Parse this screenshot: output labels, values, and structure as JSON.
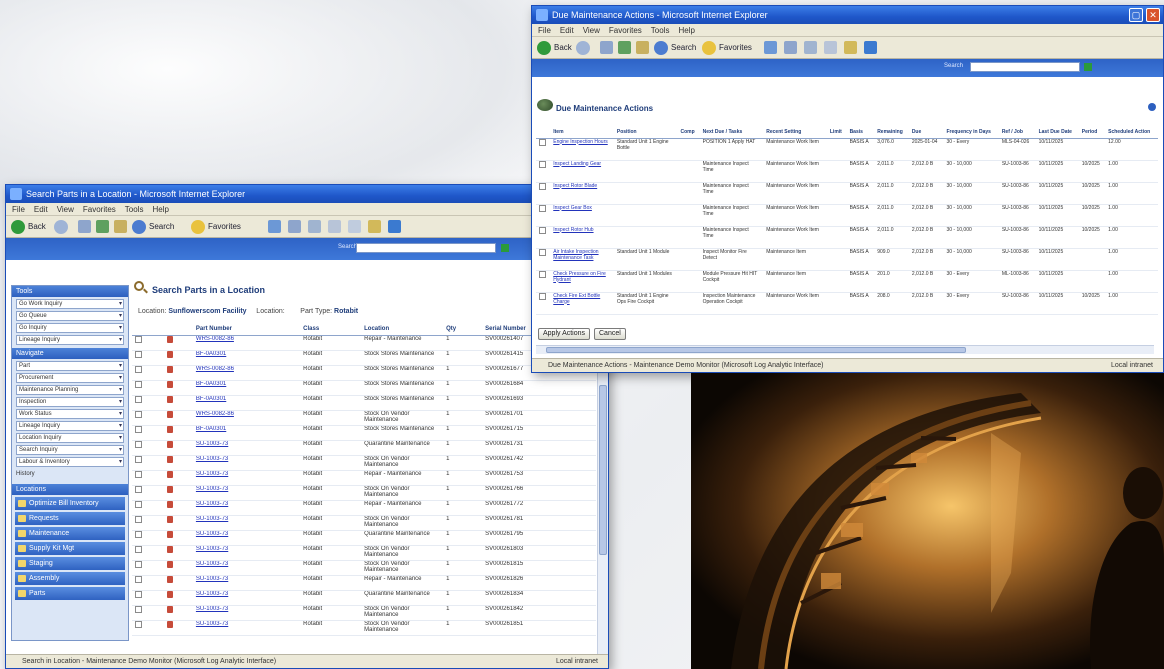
{
  "win1": {
    "title": "Search Parts in a Location - Microsoft Internet Explorer",
    "menu": [
      "File",
      "Edit",
      "View",
      "Favorites",
      "Tools",
      "Help"
    ],
    "toolbar": {
      "back": "Back",
      "search": "Search",
      "favorites": "Favorites"
    },
    "search_label": "Search",
    "page_title": "Search Parts in a Location",
    "criteria": {
      "location_label": "Location:",
      "location_value": "Sunflowerscom Facility",
      "subloc_label": "Location:",
      "parttype_label": "Part Type:",
      "parttype_value": "Rotabit"
    },
    "sidebar": {
      "header1": "Tools",
      "selects1": [
        "Go Work Inquiry",
        "Go Queue",
        "Go Inquiry",
        "Lineage Inquiry"
      ],
      "header2": "Navigate",
      "selects2": [
        "Part",
        "Procurement",
        "Maintenance Planning",
        "Inspection",
        "Work Status",
        "Lineage Inquiry",
        "Location Inquiry",
        "Search Inquiry",
        "Labour & Inventory"
      ],
      "misc": "History",
      "header3": "Locations",
      "nav": [
        "Optimize Bill Inventory",
        "Requests",
        "Maintenance",
        "Supply Kit Mgt",
        "Staging",
        "Assembly",
        "Parts"
      ]
    },
    "table": {
      "headers": [
        "Part Number",
        "Class",
        "Location",
        "Qty",
        "Serial Number"
      ],
      "rows": [
        {
          "part": "WRS-0082-86",
          "cls": "Rotabit",
          "loc": "Repair - Maintenance",
          "qty": "1",
          "serial": "SV000261407"
        },
        {
          "part": "BF-0A0301",
          "cls": "Rotabit",
          "loc": "Stock Stores Maintenance",
          "qty": "1",
          "serial": "SV000261415"
        },
        {
          "part": "WRS-0082-86",
          "cls": "Rotabit",
          "loc": "Stock Stores Maintenance",
          "qty": "1",
          "serial": "SV000261677"
        },
        {
          "part": "BF-0A0301",
          "cls": "Rotabit",
          "loc": "Stock Stores Maintenance",
          "qty": "1",
          "serial": "SV000261684"
        },
        {
          "part": "BF-0A0301",
          "cls": "Rotabit",
          "loc": "Stock Stores Maintenance",
          "qty": "1",
          "serial": "SV000261693"
        },
        {
          "part": "WRS-0082-86",
          "cls": "Rotabit",
          "loc": "Stock On Vendor Maintenance",
          "qty": "1",
          "serial": "SV000261701"
        },
        {
          "part": "BF-0A0301",
          "cls": "Rotabit",
          "loc": "Stock Stores Maintenance",
          "qty": "1",
          "serial": "SV000261715"
        },
        {
          "part": "SU-1003-73",
          "cls": "Rotabit",
          "loc": "Quarantine Maintenance",
          "qty": "1",
          "serial": "SV000261731"
        },
        {
          "part": "SU-1003-73",
          "cls": "Rotabit",
          "loc": "Stock On Vendor Maintenance",
          "qty": "1",
          "serial": "SV000261742"
        },
        {
          "part": "SU-1003-73",
          "cls": "Rotabit",
          "loc": "Repair - Maintenance",
          "qty": "1",
          "serial": "SV000261753"
        },
        {
          "part": "SU-1003-73",
          "cls": "Rotabit",
          "loc": "Stock On Vendor Maintenance",
          "qty": "1",
          "serial": "SV000261766"
        },
        {
          "part": "SU-1003-73",
          "cls": "Rotabit",
          "loc": "Repair - Maintenance",
          "qty": "1",
          "serial": "SV000261772"
        },
        {
          "part": "SU-1003-73",
          "cls": "Rotabit",
          "loc": "Stock On Vendor Maintenance",
          "qty": "1",
          "serial": "SV000261781"
        },
        {
          "part": "SU-1003-73",
          "cls": "Rotabit",
          "loc": "Quarantine Maintenance",
          "qty": "1",
          "serial": "SV000261795"
        },
        {
          "part": "SU-1003-73",
          "cls": "Rotabit",
          "loc": "Stock On Vendor Maintenance",
          "qty": "1",
          "serial": "SV000261803"
        },
        {
          "part": "SU-1003-73",
          "cls": "Rotabit",
          "loc": "Stock On Vendor Maintenance",
          "qty": "1",
          "serial": "SV000261815"
        },
        {
          "part": "SU-1003-73",
          "cls": "Rotabit",
          "loc": "Repair - Maintenance",
          "qty": "1",
          "serial": "SV000261826"
        },
        {
          "part": "SU-1003-73",
          "cls": "Rotabit",
          "loc": "Quarantine Maintenance",
          "qty": "1",
          "serial": "SV000261834"
        },
        {
          "part": "SU-1003-73",
          "cls": "Rotabit",
          "loc": "Stock On Vendor Maintenance",
          "qty": "1",
          "serial": "SV000261842"
        },
        {
          "part": "SU-1003-73",
          "cls": "Rotabit",
          "loc": "Stock On Vendor Maintenance",
          "qty": "1",
          "serial": "SV000261851"
        }
      ]
    },
    "status": "Search in Location - Maintenance Demo Monitor (Microsoft Log Analytic Interface)",
    "status_zone": "Local intranet"
  },
  "win2": {
    "title": "Due Maintenance Actions - Microsoft Internet Explorer",
    "menu": [
      "File",
      "Edit",
      "View",
      "Favorites",
      "Tools",
      "Help"
    ],
    "toolbar": {
      "back": "Back",
      "search": "Search",
      "favorites": "Favorites"
    },
    "search_label": "Search",
    "page_title": "Due Maintenance Actions",
    "table": {
      "headers": [
        "Item",
        "Position",
        "Comp",
        "Next Due / Tasks",
        "Recent Setting",
        "Limit",
        "Basis",
        "Remaining",
        "Due",
        "Frequency in Days",
        "Ref / Job",
        "Last Due Date",
        "Period",
        "Scheduled Action"
      ],
      "rows": [
        {
          "c": [
            "Engine Inspection Hours",
            "Standard Unit 1 Engine Bottle",
            "",
            "POSITION 1 Apply HAT",
            "Maintenance Work Item",
            "",
            "BASIS A",
            "3,076.0",
            "2025-01-04",
            "30 - Every",
            "MLS-04-026",
            "10/11/2025",
            "",
            "12.00"
          ]
        },
        {
          "c": [
            "Inspect Landing Gear",
            "",
            "",
            "Maintenance Inspect Time",
            "Maintenance Work Item",
            "",
            "BASIS A",
            "2,011.0",
            "2,012.0 B",
            "30 - 10,000",
            "SU-1003-86",
            "10/11/2025",
            "10/2025",
            "1.00"
          ]
        },
        {
          "c": [
            "Inspect Rotor Blade",
            "",
            "",
            "Maintenance Inspect Time",
            "Maintenance Work Item",
            "",
            "BASIS A",
            "2,011.0",
            "2,012.0 B",
            "30 - 10,000",
            "SU-1003-86",
            "10/11/2025",
            "10/2025",
            "1.00"
          ]
        },
        {
          "c": [
            "Inspect Gear Box",
            "",
            "",
            "Maintenance Inspect Time",
            "Maintenance Work Item",
            "",
            "BASIS A",
            "2,011.0",
            "2,012.0 B",
            "30 - 10,000",
            "SU-1003-86",
            "10/11/2025",
            "10/2025",
            "1.00"
          ]
        },
        {
          "c": [
            "Inspect Rotor Hub",
            "",
            "",
            "Maintenance Inspect Time",
            "Maintenance Work Item",
            "",
            "BASIS A",
            "2,011.0",
            "2,012.0 B",
            "30 - 10,000",
            "SU-1003-86",
            "10/11/2025",
            "10/2025",
            "1.00"
          ]
        },
        {
          "c": [
            "Air Intake Inspection Maintenance Task",
            "Standard Unit 1 Module",
            "",
            "Inspect Monitor Fire Detect",
            "Maintenance Item",
            "",
            "BASIS A",
            "909.0",
            "2,012.0 B",
            "30 - 10,000",
            "SU-1003-86",
            "10/11/2025",
            "",
            "1.00"
          ]
        },
        {
          "c": [
            "Check Pressure on Fire Hydrant",
            "Standard Unit 1 Modules",
            "",
            "Module Pressure Hit HIT Cockpit",
            "Maintenance Item",
            "",
            "BASIS A",
            "201.0",
            "2,012.0 B",
            "30 - Every",
            "ML-1003-86",
            "10/11/2025",
            "",
            "1.00"
          ]
        },
        {
          "c": [
            "Check Fire Ext Bottle Charge",
            "Standard Unit 1 Engine Ops Fire Cockpit",
            "",
            "Inspection Maintenance Operation Cockpit",
            "Maintenance Work Item",
            "",
            "BASIS A",
            "208.0",
            "2,012.0 B",
            "30 - Every",
            "SU-1003-86",
            "10/11/2025",
            "10/2025",
            "1.00"
          ]
        }
      ]
    },
    "buttons": {
      "apply": "Apply Actions",
      "cancel": "Cancel"
    },
    "status": "Due Maintenance Actions - Maintenance Demo Monitor (Microsoft Log Analytic Interface)",
    "status_zone": "Local intranet"
  }
}
